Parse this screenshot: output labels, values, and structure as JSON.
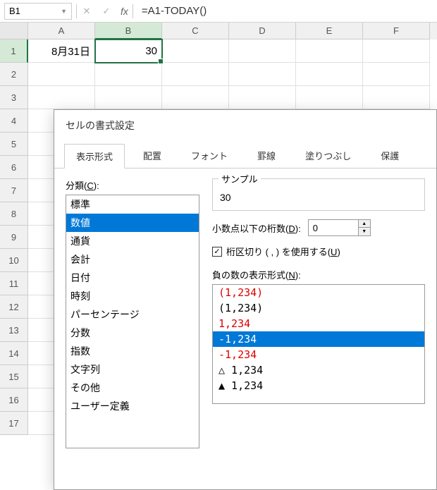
{
  "name_box": "B1",
  "formula": "=A1-TODAY()",
  "columns": [
    "A",
    "B",
    "C",
    "D",
    "E",
    "F"
  ],
  "active_col": "B",
  "active_row": 1,
  "row_count": 17,
  "cells": {
    "A1": "8月31日",
    "B1": "30"
  },
  "dialog": {
    "title": "セルの書式設定",
    "tabs": [
      "表示形式",
      "配置",
      "フォント",
      "罫線",
      "塗りつぶし",
      "保護"
    ],
    "active_tab": 0,
    "category_label_prefix": "分類(",
    "category_label_u": "C",
    "category_label_suffix": "):",
    "categories": [
      "標準",
      "数値",
      "通貨",
      "会計",
      "日付",
      "時刻",
      "パーセンテージ",
      "分数",
      "指数",
      "文字列",
      "その他",
      "ユーザー定義"
    ],
    "selected_category": 1,
    "sample_label": "サンプル",
    "sample_value": "30",
    "decimal_label_prefix": "小数点以下の桁数(",
    "decimal_label_u": "D",
    "decimal_label_suffix": "):",
    "decimal_value": "0",
    "separator_label_prefix": "桁区切り ( , ) を使用する(",
    "separator_label_u": "U",
    "separator_label_suffix": ")",
    "separator_checked": true,
    "negative_label_prefix": "負の数の表示形式(",
    "negative_label_u": "N",
    "negative_label_suffix": "):",
    "negative_formats": [
      {
        "text": "(1,234)",
        "red": true
      },
      {
        "text": "(1,234)",
        "red": false
      },
      {
        "text": "1,234",
        "red": true
      },
      {
        "text": "-1,234",
        "red": false,
        "selected": true
      },
      {
        "text": "-1,234",
        "red": true
      },
      {
        "text": "△ 1,234",
        "red": false
      },
      {
        "text": "▲ 1,234",
        "red": false
      }
    ]
  }
}
